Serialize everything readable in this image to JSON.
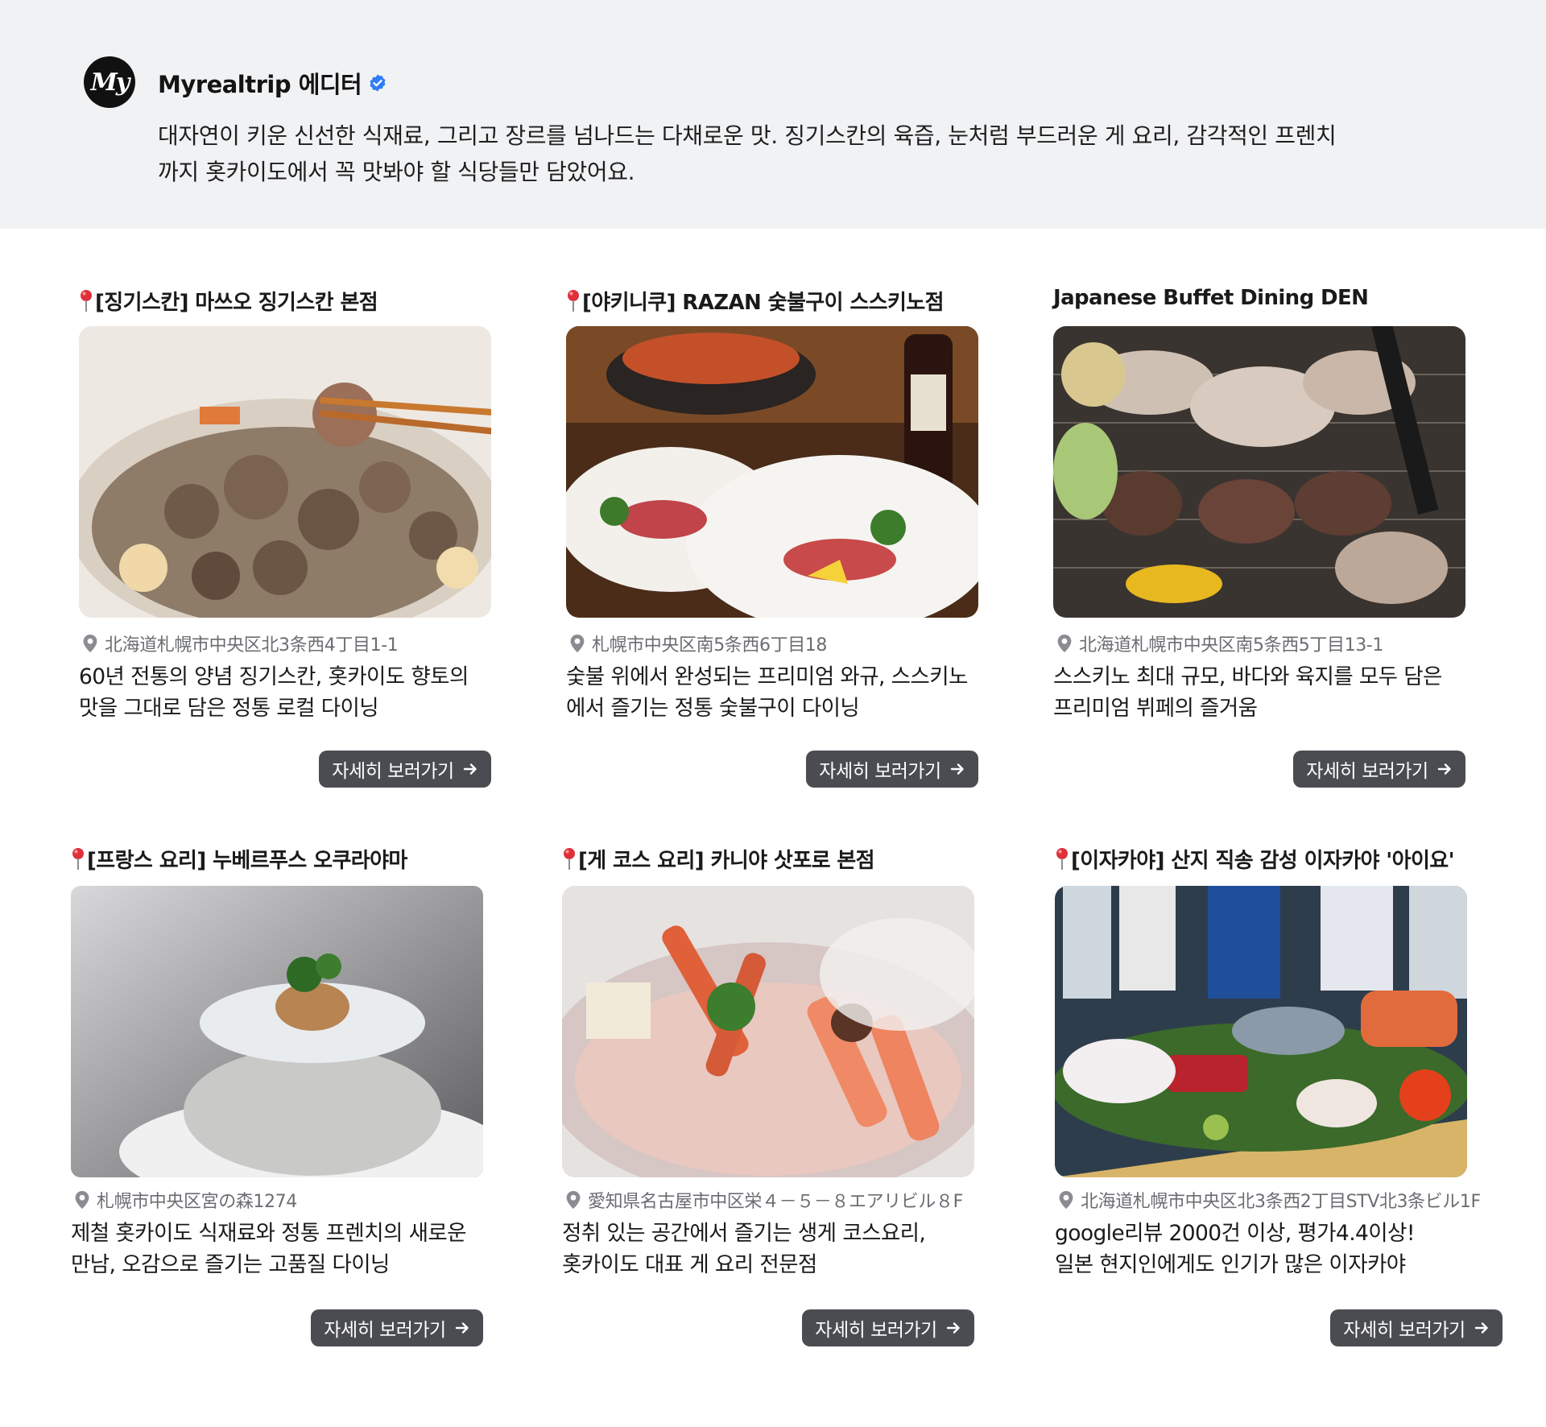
{
  "editor": {
    "avatar_text": "My",
    "name": "Myrealtrip 에디터",
    "description_line1": "대자연이 키운 신선한 식재료, 그리고 장르를 넘나드는 다채로운 맛. 징기스칸의 육즙, 눈처럼 부드러운 게 요리, 감각적인 프렌치",
    "description_line2": "까지 홋카이도에서 꼭 맛봐야 할 식당들만 담았어요.",
    "verified_color": "#2f7cf6"
  },
  "button_label": "자세히 보러가기",
  "cards": [
    {
      "title": "[징기스칸] 마쓰오 징기스칸 본점",
      "address": "北海道札幌市中央区北3条西4丁目1-1",
      "desc_line1": "60년 전통의 양념 징기스칸, 홋카이도 향토의",
      "desc_line2": "맛을 그대로 담은 정통 로컬 다이닝",
      "image_subject": "jingisukan-hotpot-photo"
    },
    {
      "title": "[야키니쿠] RAZAN 숯불구이 스스키노점",
      "address": "札幌市中央区南5条西6丁目18",
      "desc_line1": "숯불 위에서 완성되는 프리미엄 와규, 스스키노",
      "desc_line2": "에서 즐기는 정통 숯불구이 다이닝",
      "image_subject": "yakiniku-grill-photo"
    },
    {
      "title": "Japanese Buffet Dining DEN",
      "address": "北海道札幌市中央区南5条西5丁目13-1",
      "desc_line1": "스스키노 최대 규모, 바다와 육지를 모두 담은",
      "desc_line2": "프리미엄 뷔페의 즐거움",
      "image_subject": "bbq-buffet-photo"
    },
    {
      "title": "[프랑스 요리] 누베르푸스 오쿠라야마",
      "address": "札幌市中央区宮の森1274",
      "desc_line1": "제철 홋카이도 식재료와 정통 프렌치의 새로운",
      "desc_line2": "만남, 오감으로 즐기는 고품질 다이닝",
      "image_subject": "french-scallop-photo"
    },
    {
      "title": "[게 코스 요리] 카니야 삿포로 본점",
      "address": "愛知県名古屋市中区栄４－５－８エアリビル８F",
      "desc_line1": "정취 있는 공간에서 즐기는 생게 코스요리,",
      "desc_line2": "홋카이도 대표 게 요리 전문점",
      "image_subject": "crab-hotpot-photo"
    },
    {
      "title": "[이자카야] 산지 직송 감성 이자카야 '아이요'",
      "address": "北海道札幌市中央区北3条西2丁目STV北3条ビル1F",
      "desc_line1": "google리뷰 2000건 이상, 평가4.4이상!",
      "desc_line2": "일본 현지인에게도 인기가 많은 이자카야",
      "image_subject": "izakaya-seafood-platter-photo"
    }
  ]
}
